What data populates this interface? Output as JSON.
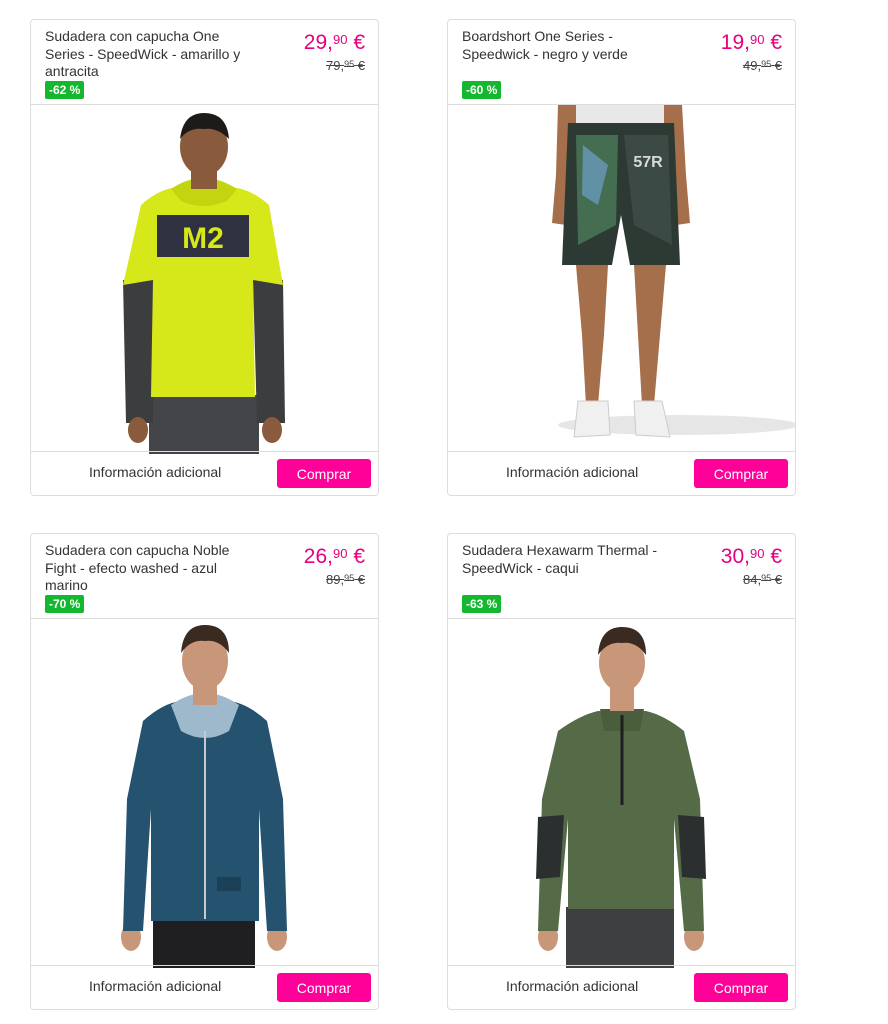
{
  "products": [
    {
      "title": "Sudadera con capucha One Series - SpeedWick - amarillo y antracita",
      "price_int": "29,",
      "price_cents": "90",
      "currency": "€",
      "old_int": "79,",
      "old_cents": "95",
      "discount": "-62 %",
      "image_text": "M2"
    },
    {
      "title": "Boardshort One Series - Speedwick - negro y verde",
      "price_int": "19,",
      "price_cents": "90",
      "currency": "€",
      "old_int": "49,",
      "old_cents": "95",
      "discount": "-60 %",
      "image_text": "57R"
    },
    {
      "title": "Sudadera con capucha Noble Fight - efecto washed - azul marino",
      "price_int": "26,",
      "price_cents": "90",
      "currency": "€",
      "old_int": "89,",
      "old_cents": "95",
      "discount": "-70 %"
    },
    {
      "title": "Sudadera Hexawarm Thermal - SpeedWick - caqui",
      "price_int": "30,",
      "price_cents": "90",
      "currency": "€",
      "old_int": "84,",
      "old_cents": "95",
      "discount": "-63 %"
    }
  ],
  "labels": {
    "info": "Información adicional",
    "buy": "Comprar"
  },
  "colors": {
    "price": "#e6007e",
    "badge": "#13b82f",
    "buy_button": "#ff0099",
    "border": "#dddddd"
  }
}
